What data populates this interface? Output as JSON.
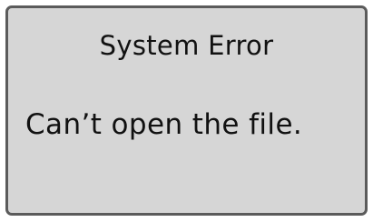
{
  "dialog": {
    "title": "System Error",
    "message": "Can’t open the file."
  }
}
